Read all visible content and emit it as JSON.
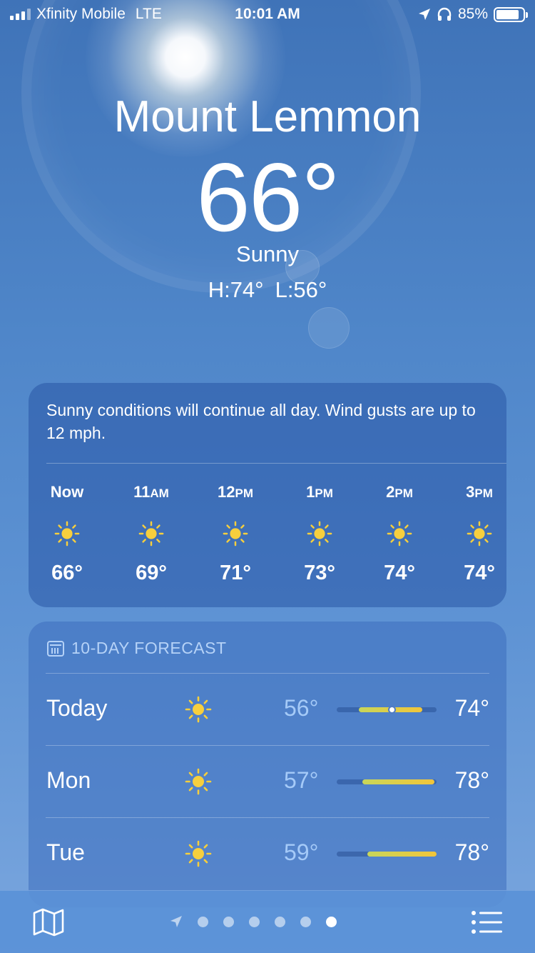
{
  "status_bar": {
    "carrier": "Xfinity Mobile",
    "network": "LTE",
    "time": "10:01 AM",
    "battery": "85%"
  },
  "header": {
    "city": "Mount Lemmon",
    "temperature": "66°",
    "condition": "Sunny",
    "high": "H:74°",
    "low": "L:56°"
  },
  "hourly": {
    "summary": "Sunny conditions will continue all day. Wind gusts are up to 12 mph.",
    "items": [
      {
        "time": "Now",
        "suffix": "",
        "icon": "sun-icon",
        "temp": "66°"
      },
      {
        "time": "11",
        "suffix": "AM",
        "icon": "sun-icon",
        "temp": "69°"
      },
      {
        "time": "12",
        "suffix": "PM",
        "icon": "sun-icon",
        "temp": "71°"
      },
      {
        "time": "1",
        "suffix": "PM",
        "icon": "sun-icon",
        "temp": "73°"
      },
      {
        "time": "2",
        "suffix": "PM",
        "icon": "sun-icon",
        "temp": "74°"
      },
      {
        "time": "3",
        "suffix": "PM",
        "icon": "sun-icon",
        "temp": "74°"
      }
    ]
  },
  "forecast": {
    "title": "10-DAY FORECAST",
    "days": [
      {
        "day": "Today",
        "icon": "sun-icon",
        "low": "56°",
        "high": "74°",
        "range_start": 0.22,
        "range_end": 0.86,
        "current": 0.55
      },
      {
        "day": "Mon",
        "icon": "sun-icon",
        "low": "57°",
        "high": "78°",
        "range_start": 0.26,
        "range_end": 0.98
      },
      {
        "day": "Tue",
        "icon": "sun-icon",
        "low": "59°",
        "high": "78°",
        "range_start": 0.31,
        "range_end": 1.0
      }
    ]
  },
  "toolbar": {
    "page_count": 7,
    "active_page": 6
  },
  "colors": {
    "sun": "#f7cf3d",
    "bar_start": "#c8d65a",
    "bar_end": "#f2c53a"
  }
}
